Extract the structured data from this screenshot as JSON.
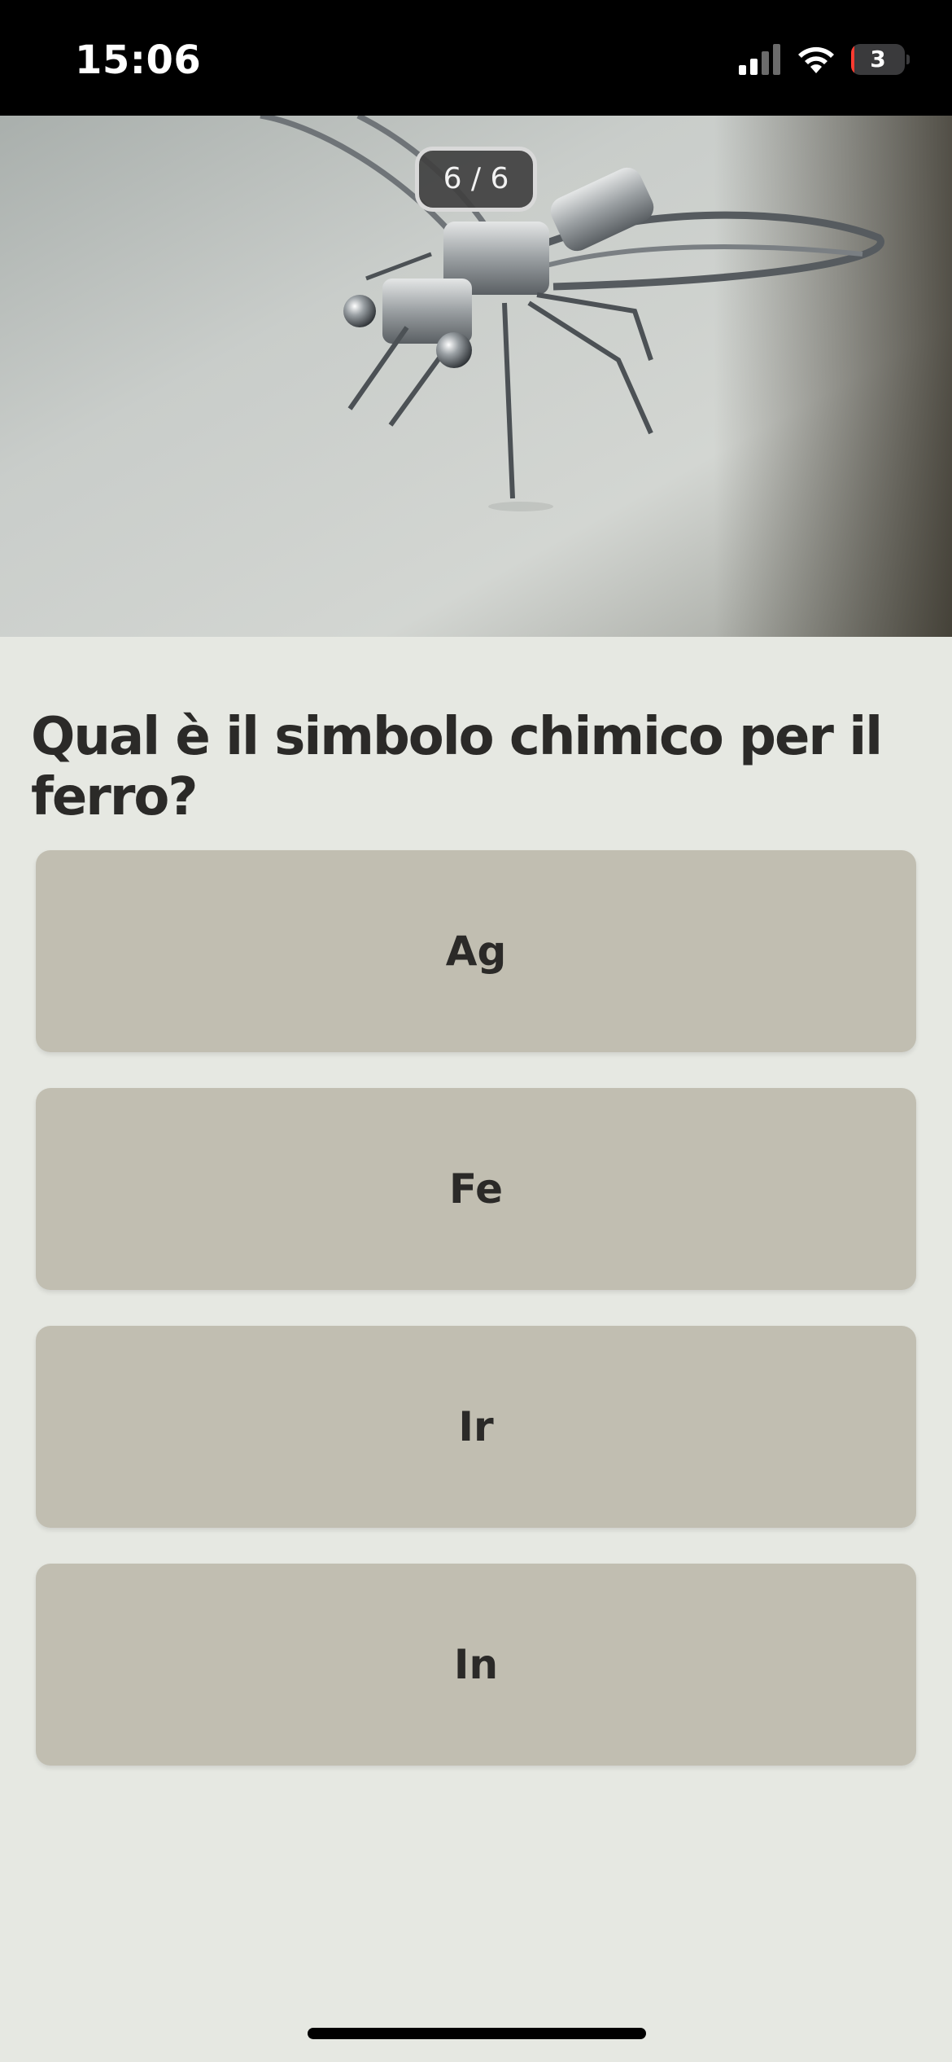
{
  "status_bar": {
    "time": "15:06",
    "battery_level": "3",
    "battery_fraction": 0.03,
    "signal_bars_active": 2,
    "signal_bars_total": 4,
    "icons": [
      "cellular-signal-icon",
      "wifi-icon",
      "battery-icon"
    ]
  },
  "quiz": {
    "progress": "6 / 6",
    "image": "photo-metal-insect-sculpture",
    "question": "Qual è il simbolo chimico per il ferro?",
    "answers": [
      "Ag",
      "Fe",
      "Ir",
      "In"
    ]
  },
  "colors": {
    "background": "#e6e8e2",
    "answer_button": "#c1beb1",
    "text": "#2b2a28",
    "status_bar": "#000000"
  }
}
